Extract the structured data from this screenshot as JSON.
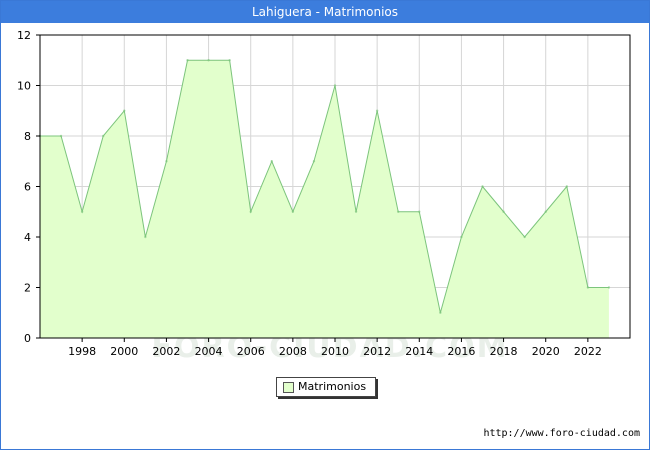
{
  "header": {
    "title": "Lahiguera - Matrimonios"
  },
  "footer": {
    "source": "http://www.foro-ciudad.com"
  },
  "watermark": "FORO-CIUDAD.COM",
  "colors": {
    "title_bar": "#3c7ddd",
    "area_fill": "#e2ffcc",
    "area_line": "#7cc47c",
    "grid": "#d6d6d6"
  },
  "chart_data": {
    "type": "area",
    "title": "Lahiguera - Matrimonios",
    "xlabel": "",
    "ylabel": "",
    "x": [
      1996,
      1997,
      1998,
      1999,
      2000,
      2001,
      2002,
      2003,
      2004,
      2005,
      2006,
      2007,
      2008,
      2009,
      2010,
      2011,
      2012,
      2013,
      2014,
      2015,
      2016,
      2017,
      2018,
      2019,
      2020,
      2021,
      2022,
      2023
    ],
    "series": [
      {
        "name": "Matrimonios",
        "values": [
          8,
          8,
          5,
          8,
          9,
          4,
          7,
          11,
          11,
          11,
          5,
          7,
          5,
          7,
          10,
          5,
          9,
          5,
          5,
          1,
          4,
          6,
          5,
          4,
          5,
          6,
          2,
          2
        ]
      }
    ],
    "xticks": [
      "1998",
      "2000",
      "2002",
      "2004",
      "2006",
      "2008",
      "2010",
      "2012",
      "2014",
      "2016",
      "2018",
      "2020",
      "2022"
    ],
    "yticks": [
      "0",
      "2",
      "4",
      "6",
      "8",
      "10",
      "12"
    ],
    "xlim": [
      1996,
      2024
    ],
    "ylim": [
      0,
      12
    ],
    "grid": true,
    "legend": "bottom-center"
  }
}
